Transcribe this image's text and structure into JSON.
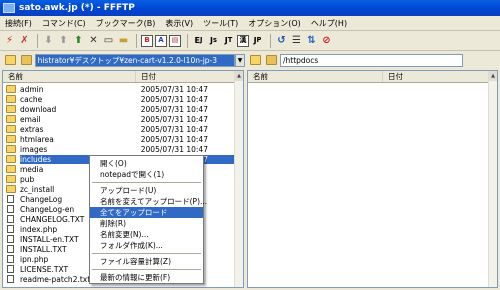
{
  "title": "sato.awk.jp (*) - FFFTP",
  "menu": [
    "接続(F)",
    "コマンド(C)",
    "ブックマーク(B)",
    "表示(V)",
    "ツール(T)",
    "オプション(O)",
    "ヘルプ(H)"
  ],
  "toolbar": {
    "icons": [
      "connect-icon",
      "disconnect-icon",
      "download-icon",
      "upload-icon",
      "delete-icon",
      "rename-icon",
      "mkdir-icon"
    ],
    "b_label": "B",
    "a_label": "A",
    "kanji_label": "漢",
    "refresh_glyph": "↺"
  },
  "left": {
    "path": "histrator¥デスクトップ¥zen-cart-v1.2.0-l10n-jp-3",
    "columns": [
      "名前",
      "日付"
    ],
    "files": [
      {
        "name": "admin",
        "date": "2005/07/31 10:47",
        "type": "folder"
      },
      {
        "name": "cache",
        "date": "2005/07/31 10:47",
        "type": "folder"
      },
      {
        "name": "download",
        "date": "2005/07/31 10:47",
        "type": "folder"
      },
      {
        "name": "email",
        "date": "2005/07/31 10:47",
        "type": "folder"
      },
      {
        "name": "extras",
        "date": "2005/07/31 10:47",
        "type": "folder"
      },
      {
        "name": "htmlarea",
        "date": "2005/07/31 10:47",
        "type": "folder"
      },
      {
        "name": "images",
        "date": "2005/07/31 10:47",
        "type": "folder"
      },
      {
        "name": "includes",
        "date": "2005/07/31 10:47",
        "type": "folder"
      },
      {
        "name": "media",
        "date": "",
        "type": "folder"
      },
      {
        "name": "pub",
        "date": "",
        "type": "folder"
      },
      {
        "name": "zc_install",
        "date": "",
        "type": "folder"
      },
      {
        "name": "ChangeLog",
        "date": "",
        "type": "file"
      },
      {
        "name": "ChangeLog-en",
        "date": "",
        "type": "file"
      },
      {
        "name": "CHANGELOG.TXT",
        "date": "",
        "type": "file"
      },
      {
        "name": "index.php",
        "date": "",
        "type": "file"
      },
      {
        "name": "INSTALL-en.TXT",
        "date": "",
        "type": "file"
      },
      {
        "name": "INSTALL.TXT",
        "date": "",
        "type": "file"
      },
      {
        "name": "ipn.php",
        "date": "",
        "type": "file"
      },
      {
        "name": "LICENSE.TXT",
        "date": "",
        "type": "file"
      },
      {
        "name": "readme-patch2.txt",
        "date": "",
        "type": "file"
      }
    ]
  },
  "right": {
    "path": "/httpdocs",
    "columns": [
      "名前",
      "日付"
    ]
  },
  "context_menu": [
    {
      "label": "開く(O)"
    },
    {
      "label": "notepadで開く(1)"
    },
    {
      "sep": true
    },
    {
      "label": "アップロード(U)"
    },
    {
      "label": "名前を変えてアップロード(P)..."
    },
    {
      "label": "全てをアップロード",
      "hover": true
    },
    {
      "label": "削除(R)"
    },
    {
      "label": "名前変更(N)..."
    },
    {
      "label": "フォルダ作成(K)..."
    },
    {
      "sep": true
    },
    {
      "label": "ファイル容量計算(Z)"
    },
    {
      "sep": true
    },
    {
      "label": "最新の情報に更新(F)"
    }
  ],
  "colors": {
    "selection": "#316ac5",
    "titlebar": "#0a5fe0"
  }
}
